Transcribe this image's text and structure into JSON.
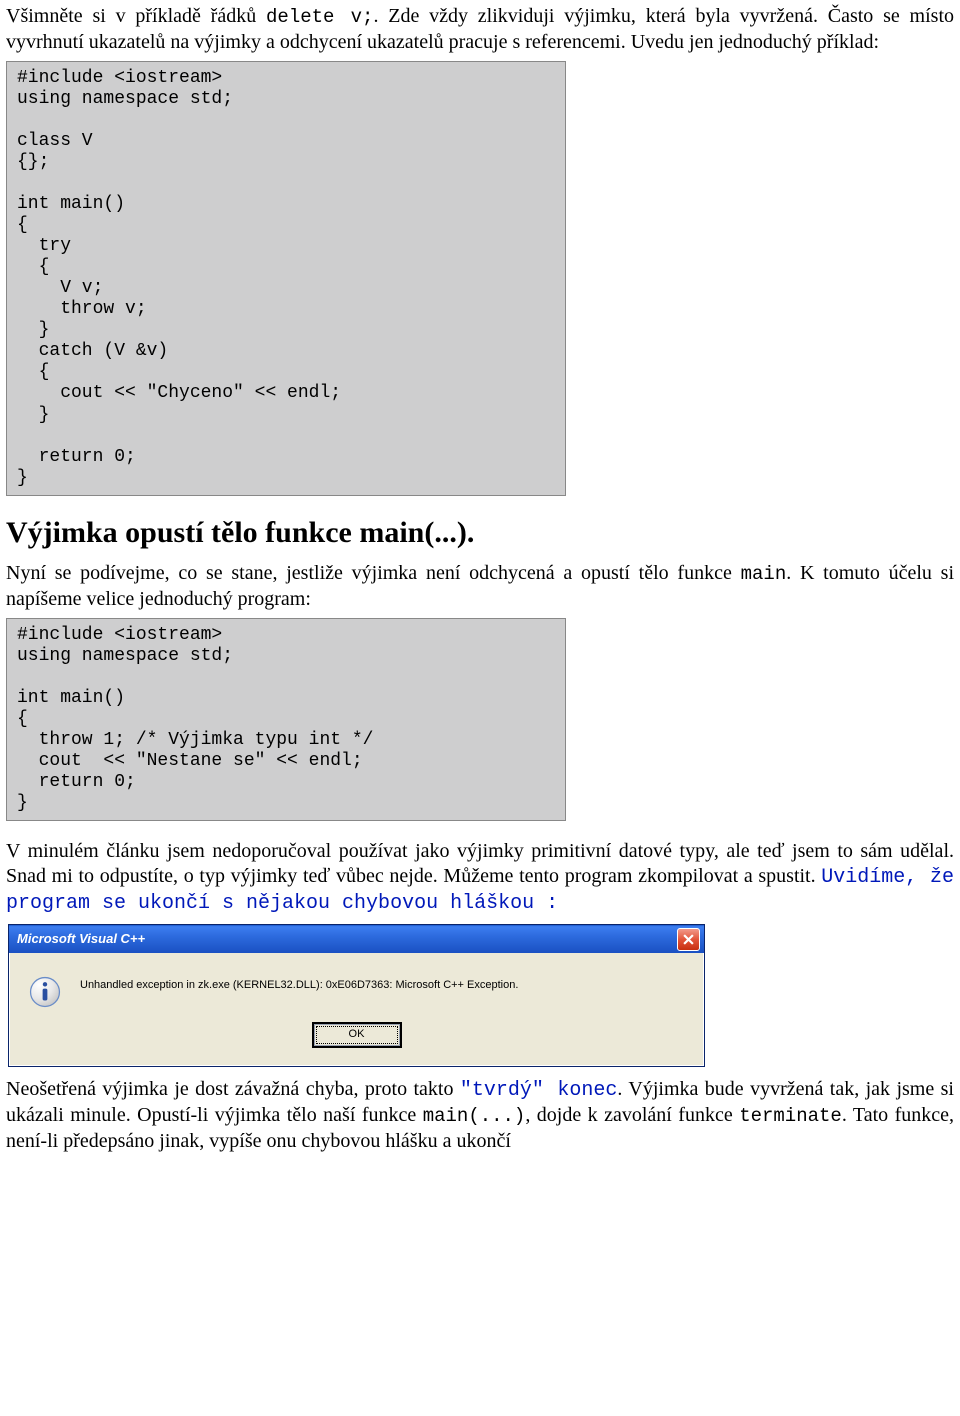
{
  "para1_a": "Všimněte si v příkladě řádků ",
  "para1_code": "delete v;",
  "para1_b": ". Zde vždy zlikviduji výjimku, která byla vyvržená. Často se místo vyvrhnutí ukazatelů na výjimky a odchycení ukazatelů pracuje s referencemi. Uvedu jen jednoduchý příklad:",
  "code1": "#include <iostream>\nusing namespace std;\n\nclass V\n{};\n\nint main()\n{\n  try\n  {\n    V v;\n    throw v;\n  }\n  catch (V &v)\n  {\n    cout << \"Chyceno\" << endl;\n  }\n\n  return 0;\n}",
  "h2": "Výjimka opustí tělo funkce main(...).",
  "para2_a": "Nyní se podívejme, co se stane, jestliže výjimka není odchycená a opustí tělo funkce ",
  "para2_code": "main",
  "para2_b": ". K tomuto účelu si napíšeme velice jednoduchý program:",
  "code2": "#include <iostream>\nusing namespace std;\n\nint main()\n{\n  throw 1; /* Výjimka typu int */\n  cout  << \"Nestane se\" << endl;\n  return 0;\n}",
  "para3_a": "V minulém článku jsem nedoporučoval používat jako výjimky primitivní datové typy, ale teď jsem to sám udělal. Snad mi to odpustíte, o typ výjimky teď vůbec nejde. Můžeme tento program zkompilovat a spustit. ",
  "para3_blue": "Uvidíme, že program se ukončí s nějakou chybovou hláškou :",
  "dialog": {
    "title": "Microsoft Visual C++",
    "message": "Unhandled exception in zk.exe (KERNEL32.DLL): 0xE06D7363: Microsoft C++ Exception.",
    "ok": "OK"
  },
  "para4_a": "Neošetřená výjimka je dost závažná chyba, proto takto ",
  "para4_code1": "\"tvrdý\" konec",
  "para4_b": ". Výjimka bude vyvržená tak, jak jsme si ukázali minule. Opustí-li výjimka tělo naší funkce ",
  "para4_code2": "main(...)",
  "para4_c": ", dojde k zavolání funkce ",
  "para4_code3": "terminate",
  "para4_d": ". Tato funkce, není-li předepsáno jinak, vypíše onu chybovou hlášku a ukončí"
}
